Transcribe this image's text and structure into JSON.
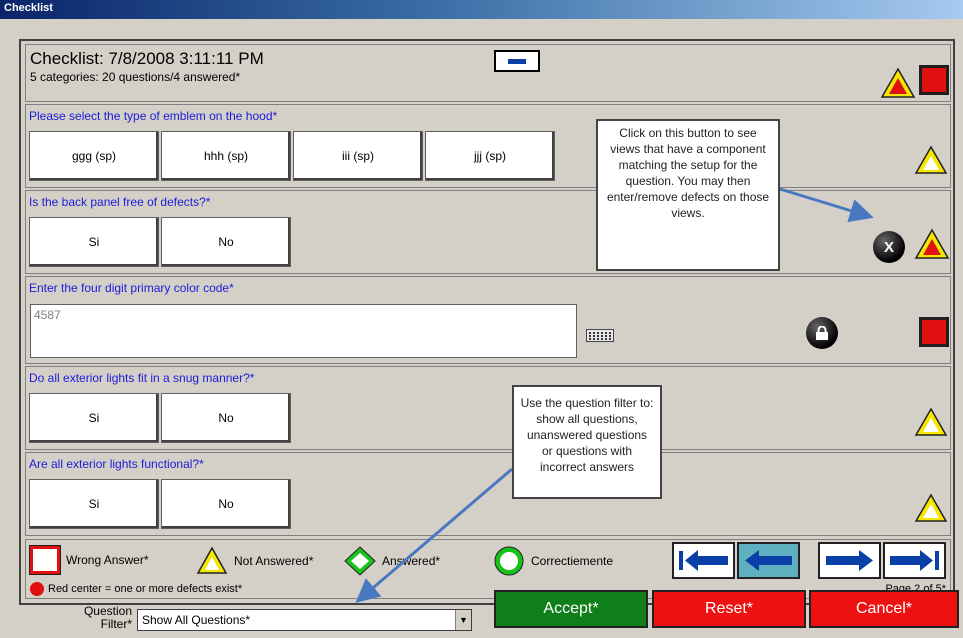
{
  "window": {
    "title": "Checklist"
  },
  "header": {
    "title": "Checklist: 7/8/2008 3:11:11 PM",
    "subtitle": "5 categories: 20 questions/4 answered*"
  },
  "questions": [
    {
      "label": "Please select the type of emblem on the hood*",
      "options": [
        "ggg (sp)",
        "hhh (sp)",
        "iii (sp)",
        "jjj (sp)"
      ],
      "status": "not-answered"
    },
    {
      "label": "Is the back panel free of defects?*",
      "options": [
        "Si",
        "No"
      ],
      "status": "not-answered-defects"
    },
    {
      "label": "Enter the four digit primary color code*",
      "value": "4587",
      "status": "wrong-answer"
    },
    {
      "label": "Do all exterior lights fit in a snug manner?*",
      "options": [
        "Si",
        "No"
      ],
      "status": "not-answered"
    },
    {
      "label": "Are all exterior lights functional?*",
      "options": [
        "Si",
        "No"
      ],
      "status": "not-answered"
    }
  ],
  "callouts": {
    "views": "Click on this button to see views that have a component matching the setup for the question. You may then enter/remove defects on those views.",
    "filter": "Use the question filter to: show all questions, unanswered questions or questions with incorrect answers"
  },
  "legend": {
    "wrong": "Wrong Answer*",
    "not_answered": "Not Answered*",
    "answered": "Answered*",
    "correct": "Correctiemente",
    "red_center": "Red center = one or more defects exist*",
    "page": "Page 2 of 5*"
  },
  "filter": {
    "label": "Question Filter*",
    "value": "Show All Questions*"
  },
  "actions": {
    "accept": "Accept*",
    "reset": "Reset*",
    "cancel": "Cancel*"
  },
  "colors": {
    "accept": "#0e7f19",
    "reset": "#ee1111",
    "cancel": "#ee1111",
    "question_text": "#1b1bd9",
    "nav_arrow": "#0b3fa8"
  },
  "icons": {
    "views": "x-circle-icon",
    "lock": "lock-icon",
    "keyboard": "keyboard-icon"
  }
}
